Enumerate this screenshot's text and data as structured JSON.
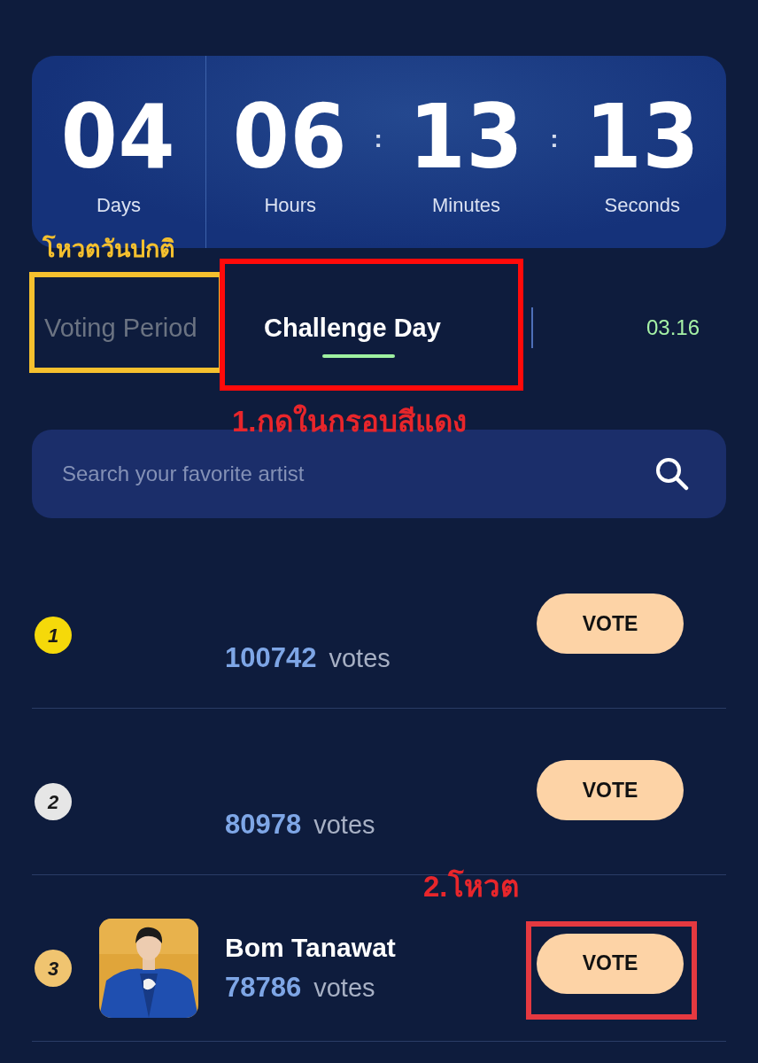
{
  "countdown": {
    "units": [
      {
        "value": "04",
        "label": "Days"
      },
      {
        "value": "06",
        "label": "Hours"
      },
      {
        "value": "13",
        "label": "Minutes"
      },
      {
        "value": "13",
        "label": "Seconds"
      }
    ],
    "separator": ":"
  },
  "tabs": [
    {
      "label": "Voting Period",
      "selected": false
    },
    {
      "label": "Challenge Day",
      "selected": true
    }
  ],
  "date": "03.16",
  "search": {
    "placeholder": "Search your favorite artist"
  },
  "rows": [
    {
      "rank": "1",
      "color": "#f5d90a",
      "votes": "100742",
      "votes_label": "votes",
      "button": "VOTE"
    },
    {
      "rank": "2",
      "color": "#e6e6e6",
      "votes": "80978",
      "votes_label": "votes",
      "button": "VOTE"
    },
    {
      "rank": "3",
      "color": "#f0c470",
      "name": "Bom Tanawat",
      "votes": "78786",
      "votes_label": "votes",
      "button": "VOTE"
    }
  ],
  "annotations": [
    {
      "kind": "label",
      "text": "โหวตวันปกติ",
      "color": "#f5c02e"
    },
    {
      "kind": "frame",
      "color": "#f5c02e"
    },
    {
      "kind": "frame",
      "color": "#ff0a0a"
    },
    {
      "kind": "label",
      "text": "1.กดในกรอบสีแดง",
      "color": "#e8262b"
    },
    {
      "kind": "label",
      "text": "2.โหวต",
      "color": "#e8262b"
    },
    {
      "kind": "frame",
      "color": "#e53940"
    }
  ]
}
